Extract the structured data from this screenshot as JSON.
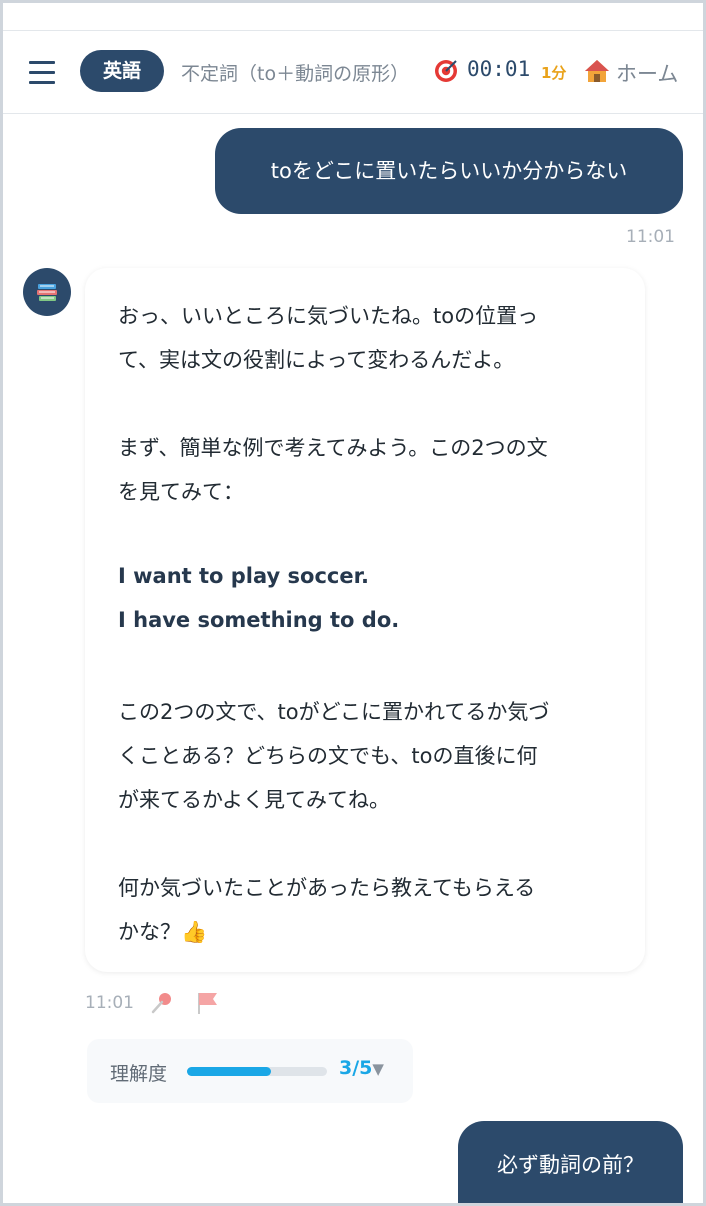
{
  "header": {
    "subject": "英語",
    "topic": "不定詞（to＋動詞の原形）",
    "timer": "00:01",
    "minutes": "1分",
    "home_label": "ホーム"
  },
  "messages": [
    {
      "role": "user",
      "text": "toをどこに置いたらいいか分からない",
      "time": "11:01"
    },
    {
      "role": "assistant",
      "lines": [
        "おっ、いいところに気づいたね。toの位置っ",
        "て、実は文の役割によって変わるんだよ。",
        "まず、簡単な例で考えてみよう。この2つの文",
        "を見てみて：",
        "I want to play soccer.",
        "I have something to do.",
        "この2つの文で、toがどこに置かれてるか気づ",
        "くことある？どちらの文でも、toの直後に何",
        "が来てるかよく見てみてね。",
        "何か気づいたことがあったら教えてもらえる",
        "かな？👍"
      ],
      "time": "11:01"
    },
    {
      "role": "user",
      "text": "必ず動詞の前？"
    }
  ],
  "understanding": {
    "label": "理解度",
    "value": "3/5",
    "level": 0.6
  },
  "icons": [
    "menu-icon",
    "target-icon",
    "home-icon",
    "books-icon",
    "pin-icon",
    "flag-icon",
    "chevron-down-icon"
  ],
  "colors": {
    "primary": "#2c4a6b",
    "accent": "#1aa7e6",
    "timer_accent": "#e9a21a"
  }
}
